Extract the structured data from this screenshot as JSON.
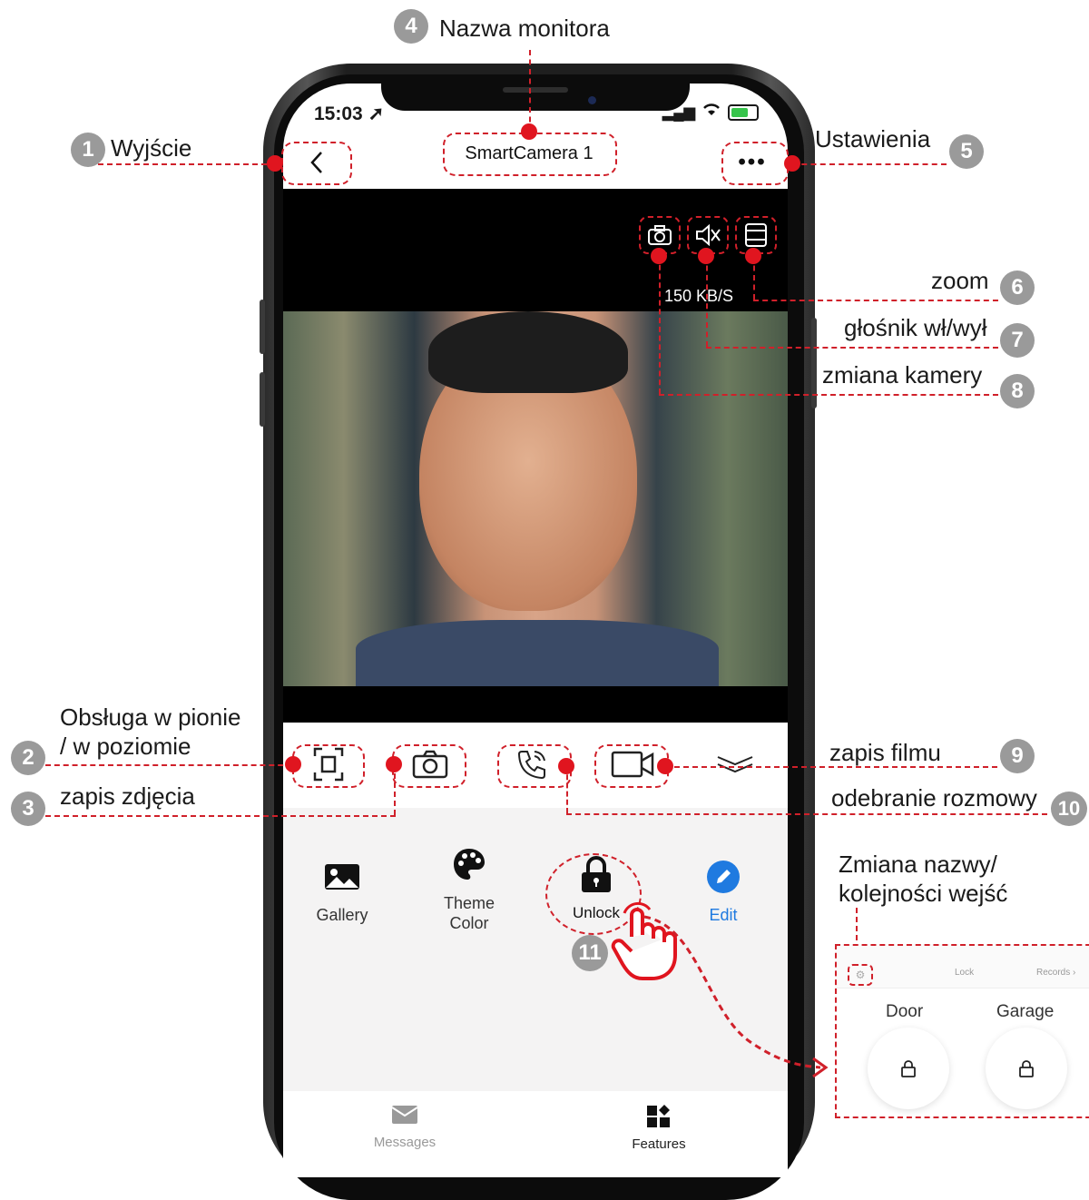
{
  "status_bar": {
    "time": "15:03",
    "location_glyph": "➚",
    "signal": "▂▄▆",
    "wifi": "ᯤ"
  },
  "header": {
    "back_glyph": "‹",
    "title": "SmartCamera 1",
    "more_glyph": "•••"
  },
  "video": {
    "speed": "150 KB/S"
  },
  "features": [
    {
      "label": "Gallery",
      "icon": "image-icon"
    },
    {
      "label": "Theme Color",
      "icon": "palette-icon"
    },
    {
      "label": "Unlock",
      "icon": "lock-icon"
    },
    {
      "label": "Edit",
      "icon": "pencil-icon"
    }
  ],
  "tabs": [
    {
      "label": "Messages",
      "icon": "mail-icon"
    },
    {
      "label": "Features",
      "icon": "grid-icon"
    }
  ],
  "annotations": {
    "a1": {
      "num": "1",
      "text": "Wyjście"
    },
    "a2": {
      "num": "2",
      "text": "Obsługa w pionie\n/ w poziomie"
    },
    "a3": {
      "num": "3",
      "text": "zapis zdjęcia"
    },
    "a4": {
      "num": "4",
      "text": "Nazwa monitora"
    },
    "a5": {
      "num": "5",
      "text": "Ustawienia"
    },
    "a6": {
      "num": "6",
      "text": "zoom"
    },
    "a7": {
      "num": "7",
      "text": "głośnik wł/wył"
    },
    "a8": {
      "num": "8",
      "text": "zmiana kamery"
    },
    "a9": {
      "num": "9",
      "text": "zapis filmu"
    },
    "a10": {
      "num": "10",
      "text": "odebranie rozmowy"
    },
    "a11": {
      "num": "11"
    },
    "a12": {
      "text": "Zmiana nazwy/\nkolejności wejść"
    }
  },
  "inset": {
    "tab_lock": "Lock",
    "records": "Records ›",
    "doors": [
      {
        "label": "Door"
      },
      {
        "label": "Garage"
      }
    ]
  },
  "colors": {
    "accent_red": "#e0151f",
    "edit_blue": "#1f7ae0",
    "battery_green": "#37c44b"
  }
}
